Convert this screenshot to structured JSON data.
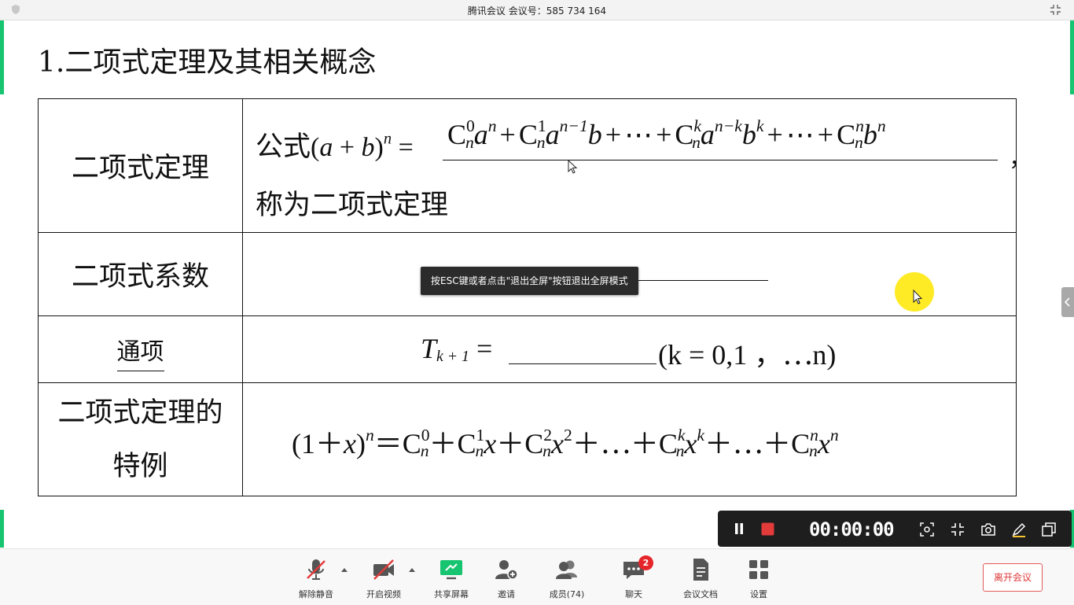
{
  "window": {
    "title": "腾讯会议 会议号：585 734 164"
  },
  "slide": {
    "title": "1.二项式定理及其相关概念",
    "rows": [
      {
        "header": "二项式定理",
        "formula_prefix": "公式",
        "formula_lhs_a": "a",
        "formula_lhs_b": "b",
        "formula_lhs_n": "n",
        "answer_terms": [
          "C",
          "0",
          "n",
          "a",
          "n",
          "+",
          "C",
          "1",
          "n",
          "a",
          "n−1",
          "b",
          "+",
          "⋯",
          "+",
          "C",
          "k",
          "n",
          "a",
          "n−k",
          "b",
          "k",
          "+",
          "⋯",
          "+",
          "C",
          "n",
          "n",
          "b",
          "n"
        ],
        "trailing": "，",
        "line2": "称为二项式定理"
      },
      {
        "header": "二项式系数"
      },
      {
        "header": "通项",
        "formula_T": "T",
        "formula_sub": "k + 1",
        "formula_tail": "(k = 0,1 ，⋯n)"
      },
      {
        "header_line1": "二项式定理的",
        "header_line2": "特例"
      }
    ]
  },
  "tooltip": {
    "text": "按ESC键或者点击\"退出全屏\"按钮退出全屏模式"
  },
  "recording": {
    "timer": "00:00:00"
  },
  "toolbar": {
    "items": [
      {
        "label": "解除静音",
        "icon": "mic-muted-icon"
      },
      {
        "label": "开启视频",
        "icon": "camera-off-icon"
      },
      {
        "label": "共享屏幕",
        "icon": "share-screen-icon"
      },
      {
        "label": "邀请",
        "icon": "invite-icon"
      },
      {
        "label": "成员(74)",
        "icon": "members-icon"
      },
      {
        "label": "聊天",
        "icon": "chat-icon",
        "badge": "2"
      },
      {
        "label": "会议文档",
        "icon": "document-icon"
      },
      {
        "label": "设置",
        "icon": "settings-icon"
      }
    ],
    "leave_label": "离开会议"
  },
  "colors": {
    "accent_green": "#17c46f",
    "answer_red": "#b51a1a",
    "leave_red": "#e0393a"
  }
}
